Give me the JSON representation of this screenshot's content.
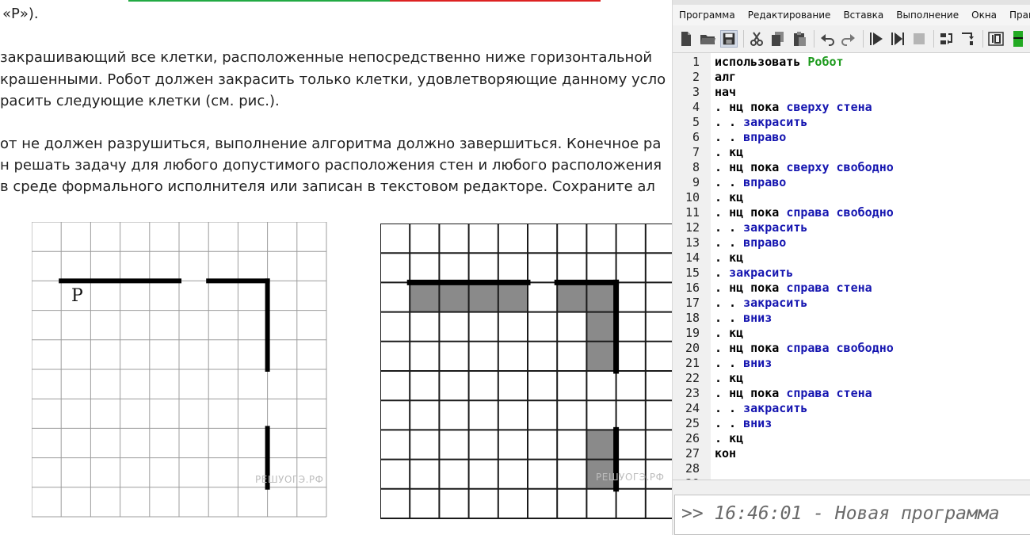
{
  "document": {
    "lines": [
      "«Р»).",
      "закрашивающий все клетки, расположенные непосредственно ниже горизонтальной",
      "крашенными. Робот должен закрасить только клетки, удовлетворяющие данному усло",
      "расить следующие клетки (см. рис.).",
      "от не должен разрушиться, выполнение алгоритма должно завершиться. Конечное ра",
      "н решать задачу для любого допустимого расположения стен и любого расположения",
      "в среде формального исполнителя или записан в текстовом редакторе. Сохраните ал"
    ],
    "strip_colors": [
      "#22aa44",
      "#dd2222"
    ],
    "figure_left": {
      "robot_label": "Р",
      "watermark": "РЕШУОГЭ.РФ"
    },
    "figure_right": {
      "watermark": "РЕШУОГЭ.РФ"
    }
  },
  "ide": {
    "menu": [
      "Программа",
      "Редактирование",
      "Вставка",
      "Выполнение",
      "Окна",
      "Практикум"
    ],
    "toolbar": [
      {
        "name": "new-file-icon"
      },
      {
        "name": "open-folder-icon"
      },
      {
        "name": "save-icon",
        "active": true
      },
      {
        "sep": true
      },
      {
        "name": "cut-icon"
      },
      {
        "name": "copy-icon"
      },
      {
        "name": "paste-icon"
      },
      {
        "sep": true
      },
      {
        "name": "undo-icon"
      },
      {
        "name": "redo-icon"
      },
      {
        "sep": true
      },
      {
        "name": "run-icon"
      },
      {
        "name": "step-run-icon"
      },
      {
        "name": "stop-icon"
      },
      {
        "sep": true
      },
      {
        "name": "step-over-icon"
      },
      {
        "name": "step-into-icon"
      },
      {
        "sep": true
      },
      {
        "name": "display-icon"
      },
      {
        "name": "green-panel-icon"
      }
    ],
    "colors": {
      "keyword": "#000000",
      "function": "#1515b0",
      "executor": "#1c9a1c"
    },
    "code_lines": [
      [
        [
          "k",
          "использовать "
        ],
        [
          "e",
          "Робот"
        ]
      ],
      [
        [
          "k",
          "алг"
        ]
      ],
      [
        [
          "k",
          "нач"
        ]
      ],
      [
        [
          "d",
          ". "
        ],
        [
          "k",
          "нц пока "
        ],
        [
          "f",
          "сверху стена"
        ]
      ],
      [
        [
          "d",
          ". . "
        ],
        [
          "f",
          "закрасить"
        ]
      ],
      [
        [
          "d",
          ". . "
        ],
        [
          "f",
          "вправо"
        ]
      ],
      [
        [
          "d",
          ". "
        ],
        [
          "k",
          "кц"
        ]
      ],
      [
        [
          "d",
          ". "
        ],
        [
          "k",
          "нц пока "
        ],
        [
          "f",
          "сверху свободно"
        ]
      ],
      [
        [
          "d",
          ". . "
        ],
        [
          "f",
          "вправо"
        ]
      ],
      [
        [
          "d",
          ". "
        ],
        [
          "k",
          "кц"
        ]
      ],
      [
        [
          "d",
          ". "
        ],
        [
          "k",
          "нц пока "
        ],
        [
          "f",
          "справа свободно"
        ]
      ],
      [
        [
          "d",
          ". . "
        ],
        [
          "f",
          "закрасить"
        ]
      ],
      [
        [
          "d",
          ". . "
        ],
        [
          "f",
          "вправо"
        ]
      ],
      [
        [
          "d",
          ". "
        ],
        [
          "k",
          "кц"
        ]
      ],
      [
        [
          "d",
          ". "
        ],
        [
          "f",
          "закрасить"
        ]
      ],
      [
        [
          "d",
          ". "
        ],
        [
          "k",
          "нц пока "
        ],
        [
          "f",
          "справа стена"
        ]
      ],
      [
        [
          "d",
          ". . "
        ],
        [
          "f",
          "закрасить"
        ]
      ],
      [
        [
          "d",
          ". . "
        ],
        [
          "f",
          "вниз"
        ]
      ],
      [
        [
          "d",
          ". "
        ],
        [
          "k",
          "кц"
        ]
      ],
      [
        [
          "d",
          ". "
        ],
        [
          "k",
          "нц пока "
        ],
        [
          "f",
          "справа свободно"
        ]
      ],
      [
        [
          "d",
          ". . "
        ],
        [
          "f",
          "вниз"
        ]
      ],
      [
        [
          "d",
          ". "
        ],
        [
          "k",
          "кц"
        ]
      ],
      [
        [
          "d",
          ". "
        ],
        [
          "k",
          "нц пока "
        ],
        [
          "f",
          "справа стена"
        ]
      ],
      [
        [
          "d",
          ". . "
        ],
        [
          "f",
          "закрасить"
        ]
      ],
      [
        [
          "d",
          ". . "
        ],
        [
          "f",
          "вниз"
        ]
      ],
      [
        [
          "d",
          ". "
        ],
        [
          "k",
          "кц"
        ]
      ],
      [
        [
          "k",
          "кон"
        ]
      ],
      [],
      []
    ],
    "console": ">> 16:46:01 - Новая программа"
  }
}
